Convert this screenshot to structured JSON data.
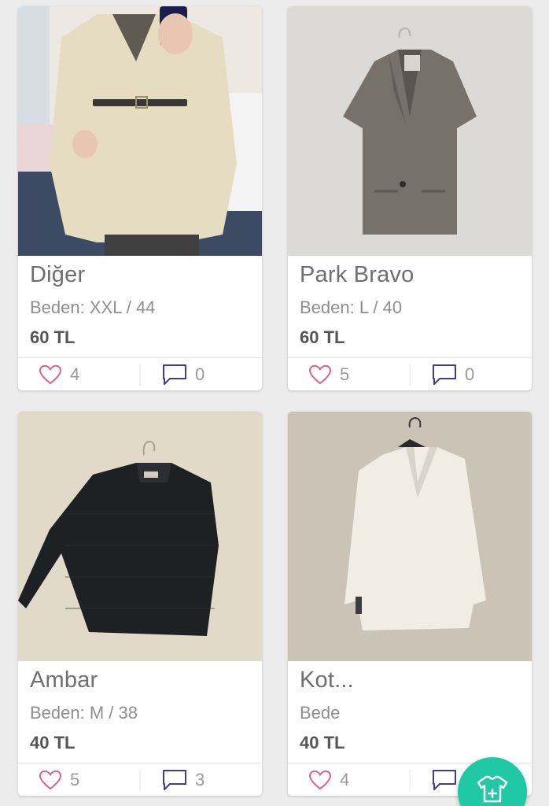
{
  "products": [
    {
      "brand": "Diğer",
      "size": "Beden: XXL / 44",
      "price": "60 TL",
      "likes": "4",
      "comments": "0"
    },
    {
      "brand": "Park Bravo",
      "size": "Beden: L / 40",
      "price": "60 TL",
      "likes": "5",
      "comments": "0"
    },
    {
      "brand": "Ambar",
      "size": "Beden: M / 38",
      "price": "40 TL",
      "likes": "5",
      "comments": "3"
    },
    {
      "brand": "Kot...",
      "size": "Bede",
      "price": "40 TL",
      "likes": "4",
      "comments": ""
    }
  ],
  "icons": {
    "like": "heart-outline-icon",
    "comment": "speech-bubble-icon",
    "fab": "add-clothing-icon"
  },
  "colors": {
    "heart": "#d9618e",
    "comment": "#3f3d8c",
    "fab": "#20c9a6"
  }
}
